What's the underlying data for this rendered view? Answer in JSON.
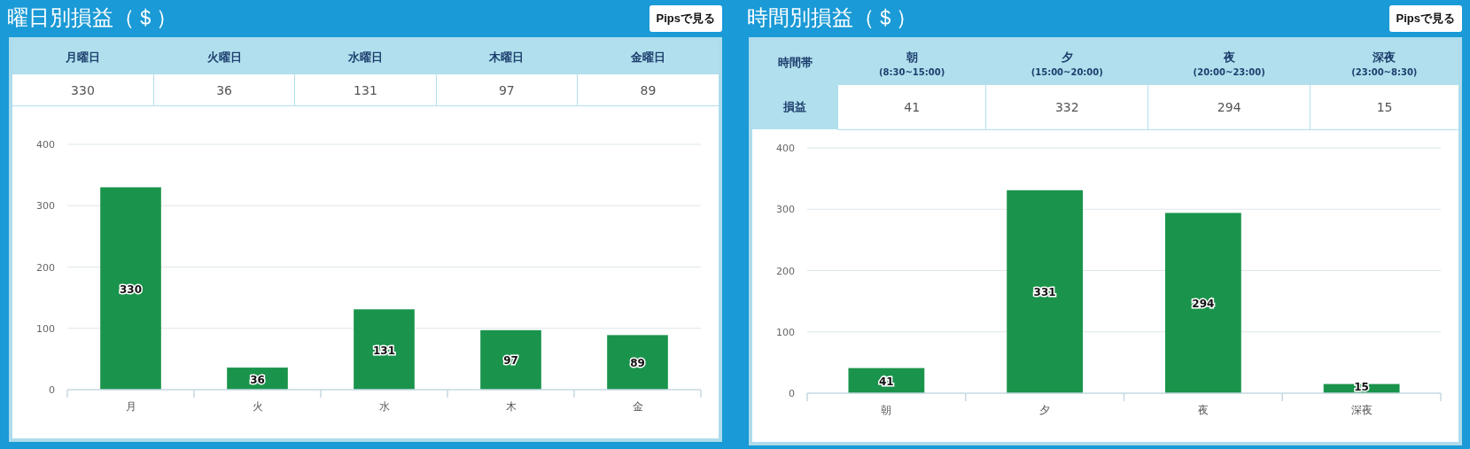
{
  "panels": [
    {
      "title": "曜日別損益（＄）",
      "button": "Pipsで見る",
      "table": {
        "kind": "columns",
        "columns": [
          {
            "label": "月曜日",
            "value": "330"
          },
          {
            "label": "火曜日",
            "value": "36"
          },
          {
            "label": "水曜日",
            "value": "131"
          },
          {
            "label": "木曜日",
            "value": "97"
          },
          {
            "label": "金曜日",
            "value": "89"
          }
        ]
      },
      "chart_data": {
        "type": "bar",
        "categories": [
          "月",
          "火",
          "水",
          "木",
          "金"
        ],
        "series": [
          {
            "color": "#1a944c",
            "values": [
              330,
              36,
              131,
              97,
              89
            ]
          }
        ],
        "ylim": [
          0,
          400
        ],
        "yticks": [
          0,
          100,
          200,
          300,
          400
        ],
        "grid": true,
        "value_labels": [
          "330",
          "36",
          "131",
          "97",
          "89"
        ]
      }
    },
    {
      "title": "時間別損益（＄）",
      "button": "Pipsで見る",
      "table": {
        "kind": "rows",
        "header_label": "時間帯",
        "value_label": "損益",
        "columns": [
          {
            "label": "朝",
            "sublabel": "(8:30~15:00)",
            "value": "41"
          },
          {
            "label": "夕",
            "sublabel": "(15:00~20:00)",
            "value": "332"
          },
          {
            "label": "夜",
            "sublabel": "(20:00~23:00)",
            "value": "294"
          },
          {
            "label": "深夜",
            "sublabel": "(23:00~8:30)",
            "value": "15"
          }
        ]
      },
      "chart_data": {
        "type": "bar",
        "categories": [
          "朝",
          "夕",
          "夜",
          "深夜"
        ],
        "series": [
          {
            "color": "#1a944c",
            "values": [
              41,
              331,
              294,
              15
            ]
          }
        ],
        "ylim": [
          0,
          400
        ],
        "yticks": [
          0,
          100,
          200,
          300,
          400
        ],
        "grid": true,
        "value_labels": [
          "41",
          "331",
          "294",
          "15"
        ]
      }
    }
  ]
}
